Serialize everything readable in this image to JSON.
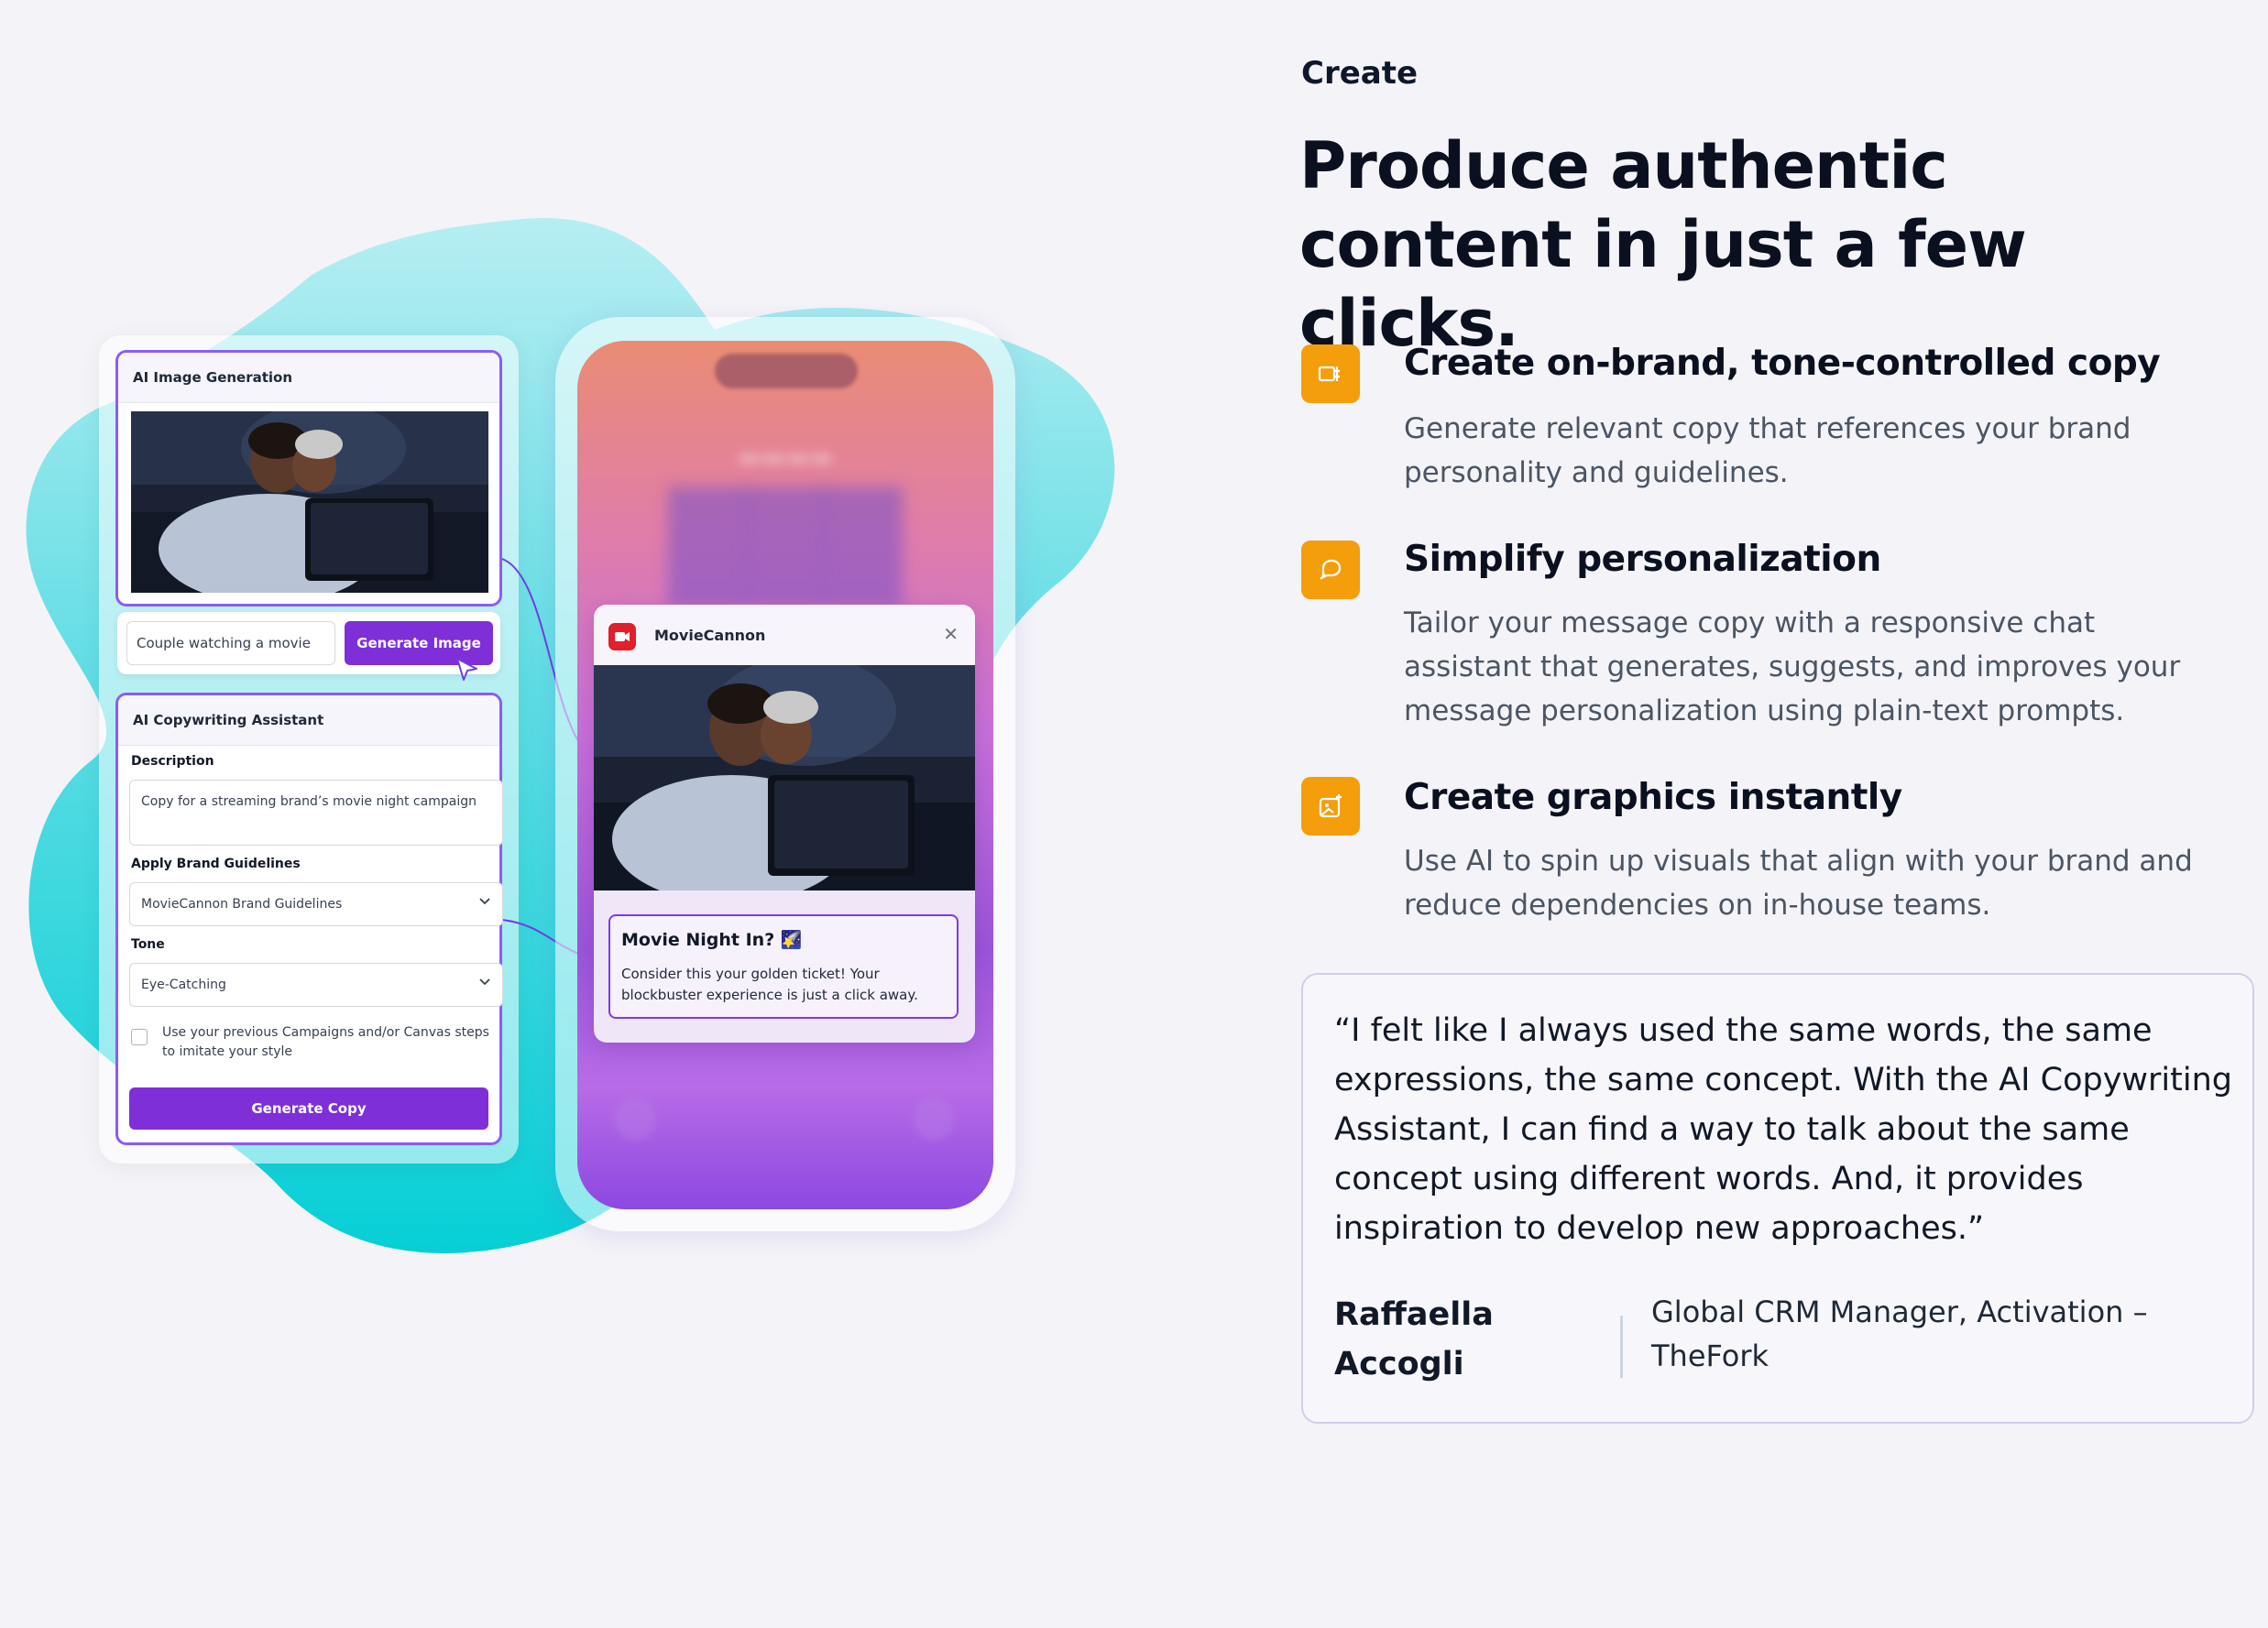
{
  "section": {
    "eyebrow": "Create",
    "headline": "Produce authentic content in just a few clicks."
  },
  "features": [
    {
      "icon": "copy-icon",
      "title": "Create on-brand, tone-controlled copy",
      "description": "Generate relevant copy that references your brand personality and guidelines."
    },
    {
      "icon": "chat-icon",
      "title": "Simplify personalization",
      "description": "Tailor your message copy with a responsive chat assistant that generates, suggests, and improves your message personalization using plain-text prompts."
    },
    {
      "icon": "image-sparkle-icon",
      "title": "Create graphics instantly",
      "description": "Use AI to spin up visuals that align with your brand and reduce dependencies on in-house teams."
    }
  ],
  "testimonial": {
    "quote": "“I felt like I always used the same words, the same expressions, the same concept. With the AI Copywriting Assistant, I can find a way to talk about the same concept using different words. And, it provides inspiration to develop new approaches.”",
    "name": "Raffaella Accogli",
    "role": "Global CRM Manager, Activation – TheFork"
  },
  "illustration": {
    "image_card": {
      "title": "AI Image Generation"
    },
    "prompt": {
      "value": "Couple watching a movie",
      "button": "Generate Image"
    },
    "copy_card": {
      "title": "AI Copywriting Assistant",
      "description_label": "Description",
      "description_value": "Copy for a streaming brand’s movie night campaign",
      "guidelines_label": "Apply Brand Guidelines",
      "guidelines_value": "MovieCannon Brand Guidelines",
      "tone_label": "Tone",
      "tone_value": "Eye-Catching",
      "checkbox_label": "Use your previous Campaigns and/or Canvas steps to imitate your style",
      "button": "Generate Copy"
    },
    "notification": {
      "app_name": "MovieCannon",
      "title": "Movie Night In? 🌠",
      "body": "Consider this your golden ticket! Your blockbuster experience is just a click away."
    },
    "colors": {
      "accent_purple": "#7e2fd8",
      "icon_orange": "#f59e0b",
      "blob_cyan": "#22d3d8"
    }
  }
}
